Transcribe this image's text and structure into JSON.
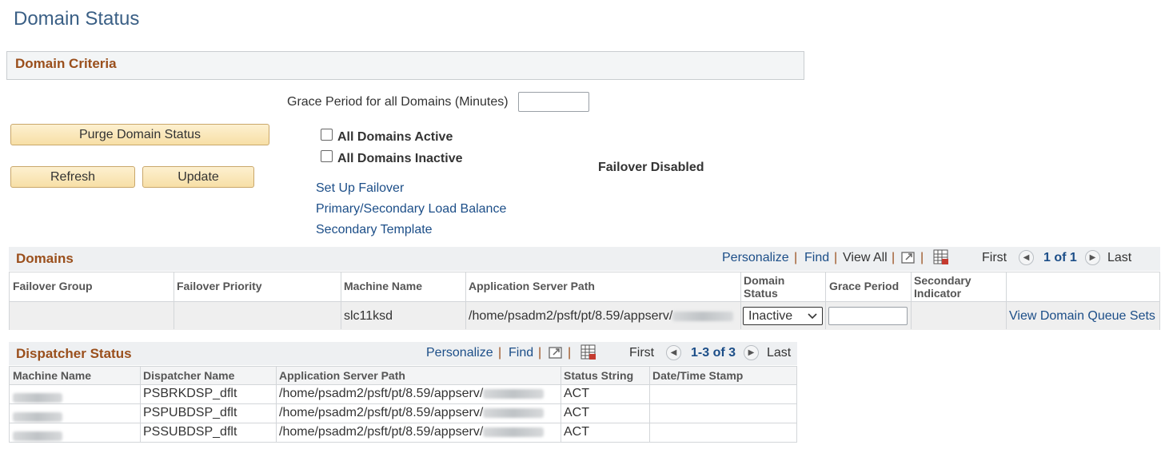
{
  "page": {
    "title": "Domain Status"
  },
  "criteria": {
    "title": "Domain Criteria",
    "grace_label": "Grace Period for all Domains (Minutes)",
    "grace_value": "",
    "purge_button": "Purge Domain Status",
    "refresh_button": "Refresh",
    "update_button": "Update",
    "all_active_label": "All Domains Active",
    "all_inactive_label": "All Domains Inactive",
    "all_active_checked": false,
    "all_inactive_checked": false,
    "failover_status": "Failover Disabled",
    "links": {
      "setup_failover": "Set Up Failover",
      "load_balance": "Primary/Secondary Load Balance",
      "secondary_template": "Secondary Template"
    }
  },
  "domains": {
    "title": "Domains",
    "personalize": "Personalize",
    "find": "Find",
    "view_all": "View All",
    "first": "First",
    "page_info": "1 of 1",
    "last": "Last",
    "headers": {
      "failover_group": "Failover Group",
      "failover_priority": "Failover Priority",
      "machine_name": "Machine Name",
      "app_server_path": "Application Server Path",
      "domain_status_1": "Domain",
      "domain_status_2": "Status",
      "grace_period": "Grace Period",
      "secondary_1": "Secondary",
      "secondary_2": "Indicator"
    },
    "row": {
      "failover_group": "",
      "failover_priority": "",
      "machine_name": "slc11ksd",
      "app_server_path": "/home/psadm2/psft/pt/8.59/appserv/",
      "domain_status": "Inactive",
      "grace_period": "",
      "secondary_indicator": "",
      "action_link": "View Domain Queue Sets"
    }
  },
  "dispatcher": {
    "title": "Dispatcher Status",
    "personalize": "Personalize",
    "find": "Find",
    "first": "First",
    "page_info": "1-3 of 3",
    "last": "Last",
    "headers": {
      "machine_name": "Machine Name",
      "dispatcher_name": "Dispatcher Name",
      "app_server_path": "Application Server Path",
      "status_string": "Status String",
      "datetime": "Date/Time Stamp"
    },
    "rows": [
      {
        "dispatcher_name": "PSBRKDSP_dflt",
        "app_server_path": "/home/psadm2/psft/pt/8.59/appserv/",
        "status_string": "ACT",
        "datetime": ""
      },
      {
        "dispatcher_name": "PSPUBDSP_dflt",
        "app_server_path": "/home/psadm2/psft/pt/8.59/appserv/",
        "status_string": "ACT",
        "datetime": ""
      },
      {
        "dispatcher_name": "PSSUBDSP_dflt",
        "app_server_path": "/home/psadm2/psft/pt/8.59/appserv/",
        "status_string": "ACT",
        "datetime": ""
      }
    ]
  },
  "colors": {
    "section_title": "#9a4f1c",
    "link": "#1c4e88",
    "page_title": "#3a5f85",
    "button_bg": "#f7dfa6"
  }
}
